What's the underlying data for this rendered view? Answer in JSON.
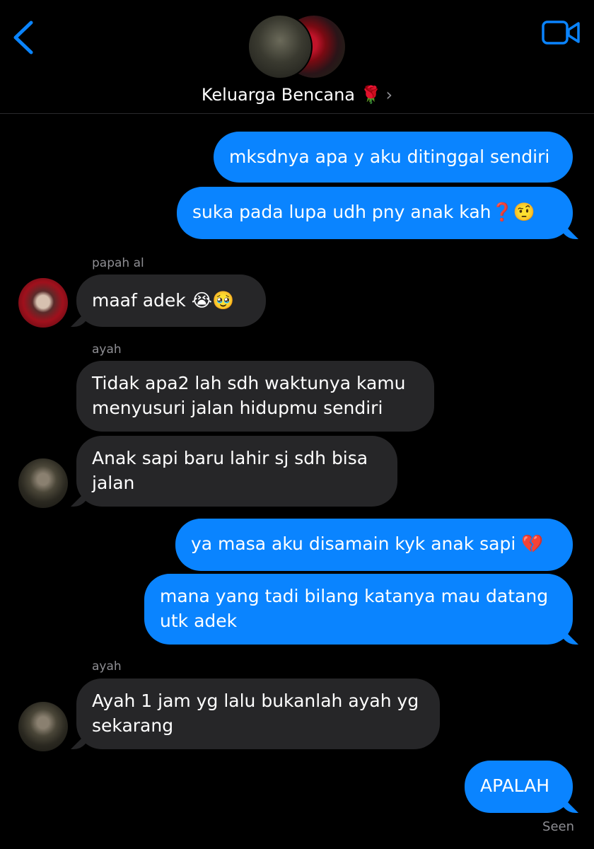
{
  "header": {
    "title": "Keluarga Bencana 🌹",
    "chevron": "›",
    "back_icon": "chevron-left-icon",
    "video_icon": "video-camera-icon",
    "accent": "#0a84ff"
  },
  "messages": {
    "m1": "mksdnya apa y aku ditinggal sendiri",
    "m2": "suka pada lupa udh pny anak kah❓🤨",
    "n1": "papah al",
    "m3": "maaf adek 😭🥹",
    "n2": "ayah",
    "m4a": "Tidak apa2 lah sdh waktunya kamu",
    "m4b": "menyusuri jalan hidupmu sendiri",
    "m5a": "Anak sapi baru lahir sj sdh bisa",
    "m5b": "jalan",
    "m6": "ya masa aku disamain kyk anak sapi 💔",
    "m7a": "mana yang tadi bilang katanya mau datang",
    "m7b": "utk adek",
    "n3": "ayah",
    "m8a": "Ayah 1 jam yg lalu bukanlah ayah yg",
    "m8b": "sekarang",
    "m9": "APALAH"
  },
  "status": {
    "seen": "Seen"
  }
}
